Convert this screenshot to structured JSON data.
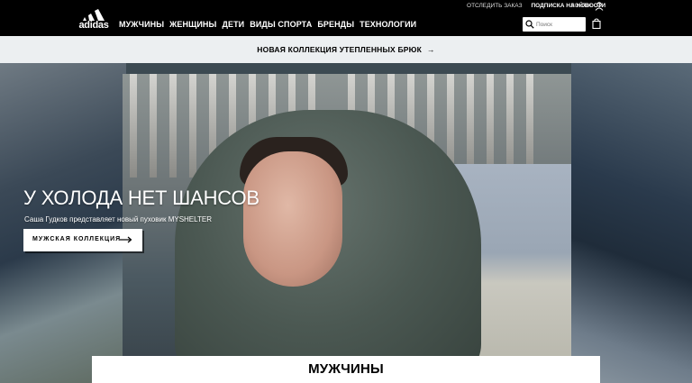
{
  "header": {
    "logo_text": "adidas",
    "utility_links": [
      "ОТСЛЕДИТЬ ЗАКАЗ",
      "ПОДПИСКА НА НОВОСТИ"
    ],
    "login": "ВОЙТИ",
    "nav_items": [
      "МУЖЧИНЫ",
      "ЖЕНЩИНЫ",
      "ДЕТИ",
      "ВИДЫ СПОРТА",
      "БРЕНДЫ",
      "ТЕХНОЛОГИИ"
    ],
    "search_placeholder": "Поиск"
  },
  "promo": {
    "text": "НОВАЯ КОЛЛЕКЦИЯ УТЕПЛЕННЫХ БРЮК",
    "arrow": "→"
  },
  "hero": {
    "headline": "У ХОЛОДА НЕТ ШАНСОВ",
    "subline": "Саша Гудков представляет новый пуховик MYSHELTER",
    "cta_label": "МУЖСКАЯ КОЛЛЕКЦИЯ"
  },
  "section": {
    "title": "МУЖЧИНЫ"
  },
  "colors": {
    "header_bg": "#000000",
    "promo_bg": "#eceff1",
    "text_on_dark": "#ffffff"
  },
  "icons": [
    "adidas-logo-icon",
    "user-icon",
    "search-icon",
    "shopping-bag-icon",
    "arrow-right-icon"
  ]
}
